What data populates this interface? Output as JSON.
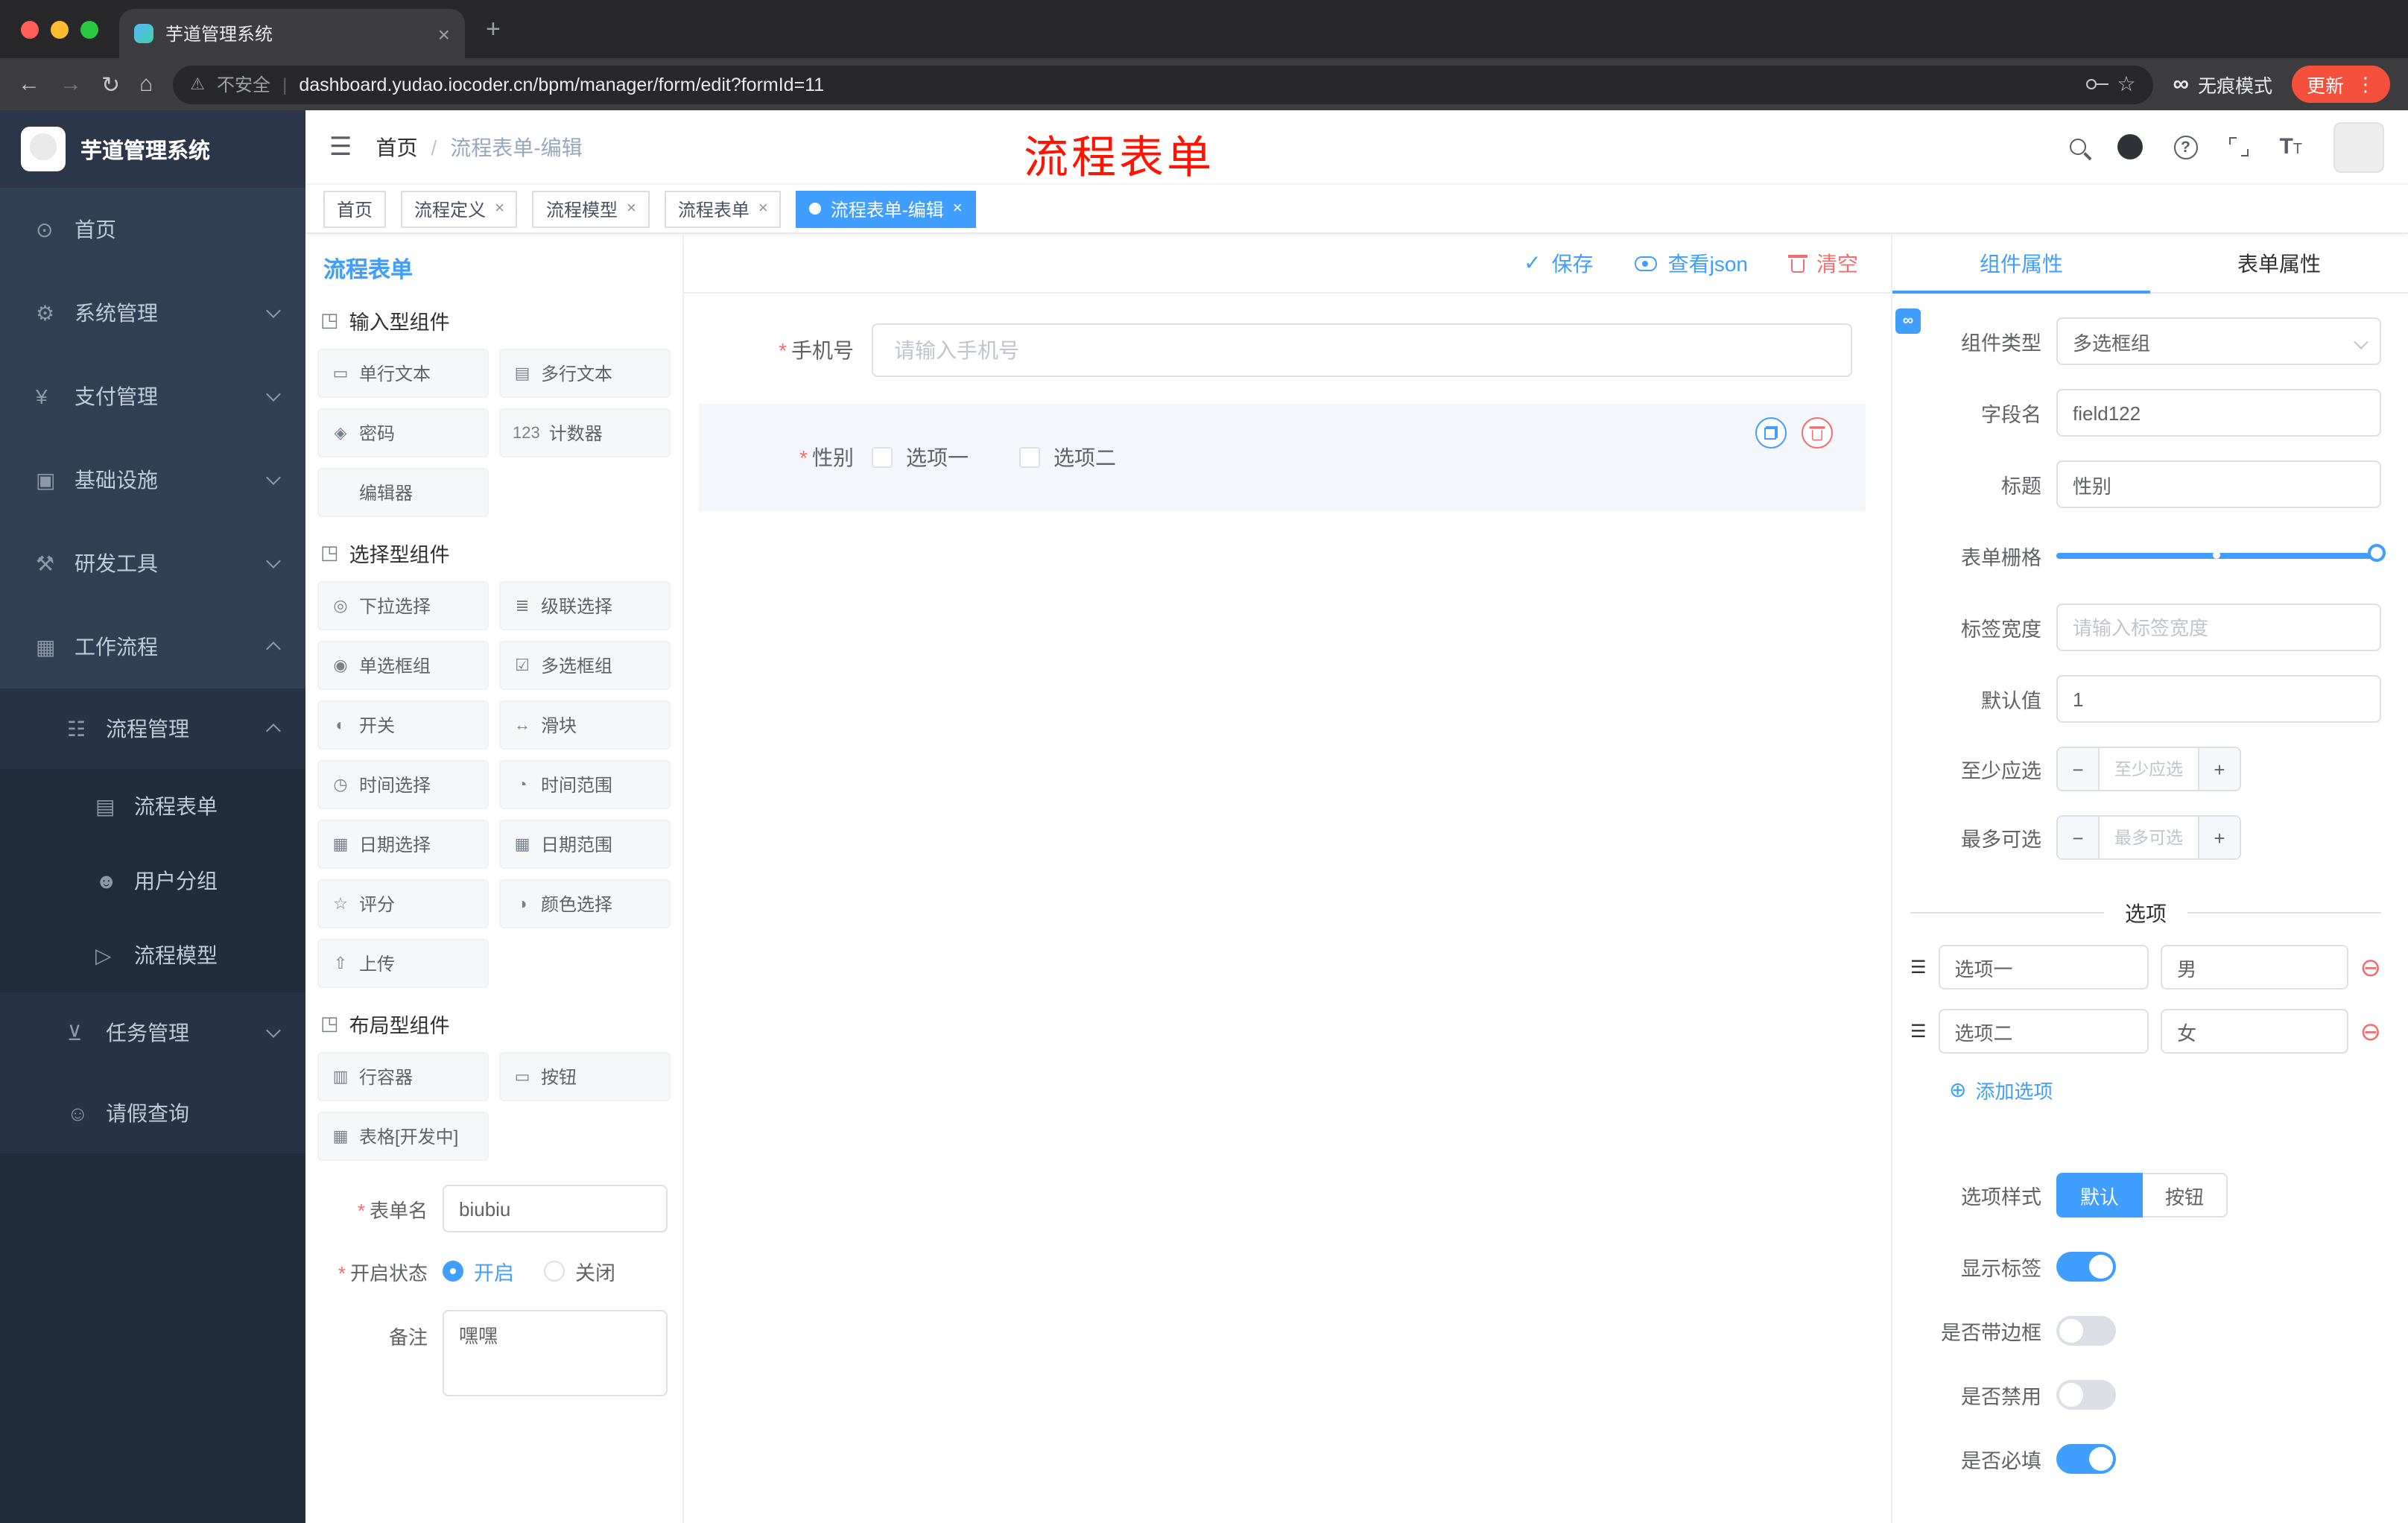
{
  "theme": {
    "accent": "#409EFF",
    "danger": "#F56C6C",
    "annotation_red": "#FE1400",
    "update_button": "#F4503C",
    "sidebar_bg": "#304156"
  },
  "browser": {
    "tab_title": "芋道管理系统",
    "close_tab": "×",
    "new_tab": "+",
    "back": "←",
    "forward": "→",
    "reload": "↻",
    "home": "⌂",
    "warn_icon": "⚠",
    "security_label": "不安全",
    "url_sep": "|",
    "url": "dashboard.yudao.iocoder.cn/bpm/manager/form/edit?formId=11",
    "star_icon": "☆",
    "incognito_icon": "∞",
    "incognito_label": "无痕模式",
    "update_label": "更新",
    "menu_dots": "⋮"
  },
  "sidebar": {
    "logo_title": "芋道管理系统",
    "items": [
      {
        "label": "首页",
        "icon": "⊙"
      },
      {
        "label": "系统管理",
        "icon": "⚙"
      },
      {
        "label": "支付管理",
        "icon": "¥"
      },
      {
        "label": "基础设施",
        "icon": "▣"
      },
      {
        "label": "研发工具",
        "icon": "⚒"
      },
      {
        "label": "工作流程",
        "icon": "▦"
      },
      {
        "label": "流程管理",
        "icon": "☷"
      },
      {
        "label": "流程表单",
        "icon": "▤"
      },
      {
        "label": "用户分组",
        "icon": "☻"
      },
      {
        "label": "流程模型",
        "icon": "▷"
      },
      {
        "label": "任务管理",
        "icon": "⊻"
      },
      {
        "label": "请假查询",
        "icon": "☺"
      }
    ]
  },
  "header": {
    "hamburger": "☰",
    "breadcrumb_home": "首页",
    "breadcrumb_sep": "/",
    "breadcrumb_current": "流程表单-编辑",
    "annotation": "流程表单",
    "question_mark": "?",
    "tsize_big": "T",
    "tsize_small": "T"
  },
  "tags": [
    {
      "label": "首页",
      "close": ""
    },
    {
      "label": "流程定义",
      "close": "×"
    },
    {
      "label": "流程模型",
      "close": "×"
    },
    {
      "label": "流程表单",
      "close": "×"
    },
    {
      "label": "流程表单-编辑",
      "close": "×"
    }
  ],
  "designer": {
    "title": "流程表单",
    "toolbar": {
      "save_icon": "✓",
      "save": "保存",
      "view_json": "查看json",
      "clear": "清空"
    }
  },
  "palette": {
    "sections": [
      {
        "title": "输入型组件",
        "icon": "◳",
        "items": [
          {
            "label": "单行文本",
            "icon": "▭"
          },
          {
            "label": "多行文本",
            "icon": "▤"
          },
          {
            "label": "密码",
            "icon": "◈"
          },
          {
            "label": "计数器",
            "icon": "123"
          },
          {
            "label": "编辑器",
            "icon": ""
          }
        ]
      },
      {
        "title": "选择型组件",
        "icon": "◳",
        "items": [
          {
            "label": "下拉选择",
            "icon": "◎"
          },
          {
            "label": "级联选择",
            "icon": "≣"
          },
          {
            "label": "单选框组",
            "icon": "◉"
          },
          {
            "label": "多选框组",
            "icon": "☑"
          },
          {
            "label": "开关",
            "icon": "◐"
          },
          {
            "label": "滑块",
            "icon": "↔"
          },
          {
            "label": "时间选择",
            "icon": "◷"
          },
          {
            "label": "时间范围",
            "icon": "◔"
          },
          {
            "label": "日期选择",
            "icon": "▦"
          },
          {
            "label": "日期范围",
            "icon": "▦"
          },
          {
            "label": "评分",
            "icon": "☆"
          },
          {
            "label": "颜色选择",
            "icon": "◑"
          },
          {
            "label": "上传",
            "icon": "⇧"
          }
        ]
      },
      {
        "title": "布局型组件",
        "icon": "◳",
        "items": [
          {
            "label": "行容器",
            "icon": "▥"
          },
          {
            "label": "按钮",
            "icon": "▭"
          },
          {
            "label": "表格[开发中]",
            "icon": "▦"
          }
        ]
      }
    ],
    "form": {
      "name_label": "表单名",
      "name_value": "biubiu",
      "status_label": "开启状态",
      "status_on": "开启",
      "status_off": "关闭",
      "remark_label": "备注",
      "remark_value": "嘿嘿"
    }
  },
  "canvas": {
    "phone_field": {
      "label": "手机号",
      "placeholder": "请输入手机号"
    },
    "gender_field": {
      "label": "性别",
      "option1": "选项一",
      "option2": "选项二"
    }
  },
  "props": {
    "tabs": {
      "component": "组件属性",
      "form": "表单属性"
    },
    "link_icon": "∞",
    "component_type_label": "组件类型",
    "component_type_value": "多选框组",
    "field_name_label": "字段名",
    "field_name_value": "field122",
    "title_label": "标题",
    "title_value": "性别",
    "grid_label": "表单栅格",
    "label_width_label": "标签宽度",
    "label_width_placeholder": "请输入标签宽度",
    "default_label": "默认值",
    "default_value": "1",
    "min_label": "至少应选",
    "min_placeholder": "至少应选",
    "max_label": "最多可选",
    "max_placeholder": "最多可选",
    "stepper_minus": "−",
    "stepper_plus": "+",
    "options_title": "选项",
    "options": [
      {
        "name": "选项一",
        "value": "男"
      },
      {
        "name": "选项二",
        "value": "女"
      }
    ],
    "remove_icon": "⊖",
    "drag_icon": "☰",
    "add_icon": "⊕",
    "add_option": "添加选项",
    "style_label": "选项样式",
    "style_default": "默认",
    "style_button": "按钮",
    "switch_show_label": "显示标签",
    "switch_border": "是否带边框",
    "switch_disabled": "是否禁用",
    "switch_required": "是否必填"
  }
}
